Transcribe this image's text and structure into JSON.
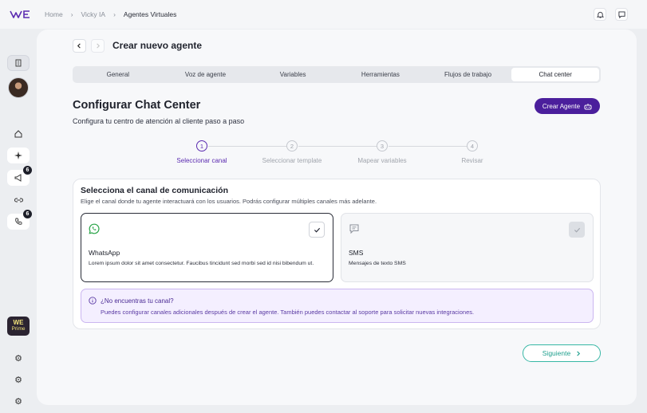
{
  "brand": {
    "logo_text": "WE",
    "accent": "#4b1f9c",
    "teal": "#37b7a5"
  },
  "breadcrumb": [
    "Home",
    "Vicky IA",
    "Agentes Virtuales"
  ],
  "header": {
    "title": "Crear nuevo agente"
  },
  "sidebar": {
    "badges": {
      "announce": "6",
      "calls": "6"
    },
    "prime": {
      "logo": "WE",
      "label": "Prime"
    },
    "icons": [
      "building-icon",
      "home-icon",
      "sparkle-icon",
      "megaphone-icon",
      "link-icon",
      "phone-icon",
      "gear-icon",
      "gear-icon",
      "gear-icon"
    ]
  },
  "tabs": [
    {
      "label": "General",
      "active": false
    },
    {
      "label": "Voz de agente",
      "active": false
    },
    {
      "label": "Variables",
      "active": false
    },
    {
      "label": "Herramientas",
      "active": false
    },
    {
      "label": "Flujos de trabajo",
      "active": false
    },
    {
      "label": "Chat center",
      "active": true
    }
  ],
  "section": {
    "title": "Configurar Chat Center",
    "subtitle": "Configura tu centro de atención al cliente paso a paso",
    "create_button": "Crear Agente"
  },
  "steps": [
    {
      "number": "1",
      "label": "Seleccionar canal",
      "active": true
    },
    {
      "number": "2",
      "label": "Seleccionar template",
      "active": false
    },
    {
      "number": "3",
      "label": "Mapear variables",
      "active": false
    },
    {
      "number": "4",
      "label": "Revisar",
      "active": false
    }
  ],
  "channel_card": {
    "title": "Selecciona el canal de comunicación",
    "subtitle": "Elige el canal donde tu agente interactuará con los usuarios. Podrás configurar múltiples canales más adelante.",
    "options": [
      {
        "name": "WhatsApp",
        "description": "Lorem ipsum dolor sit amet consectetur. Faucibus tincidunt sed morbi sed id nisi bibendum ut.",
        "selected": true,
        "icon": "whatsapp-icon"
      },
      {
        "name": "SMS",
        "description": "Mensajes de texto SMS",
        "selected": false,
        "icon": "message-icon"
      }
    ],
    "info": {
      "title": "¿No encuentras tu canal?",
      "text": "Puedes configurar canales adicionales después de crear el agente. También puedes contactar al soporte para solicitar nuevas integraciones."
    }
  },
  "next_button": "Siguiente"
}
